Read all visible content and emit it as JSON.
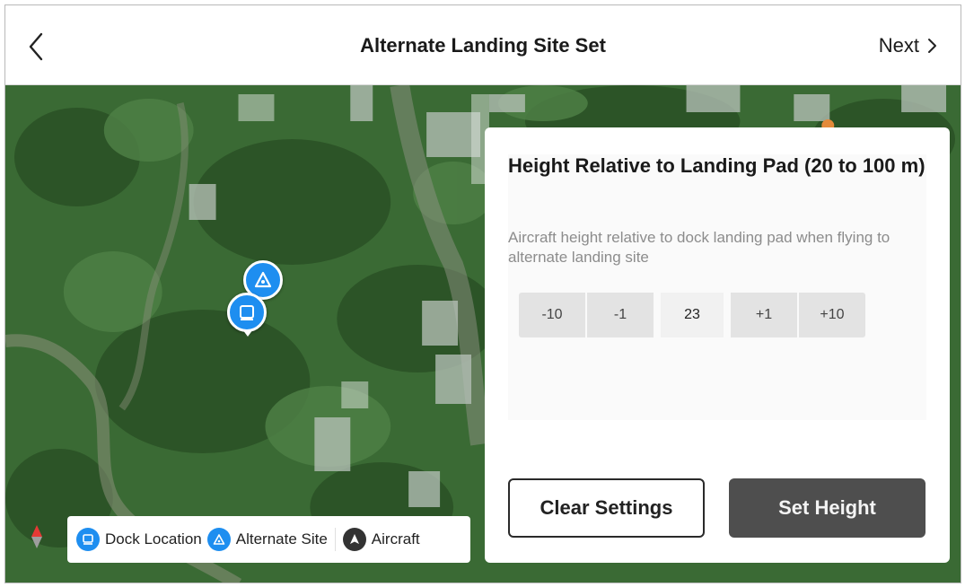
{
  "header": {
    "title": "Alternate Landing Site Set",
    "next_label": "Next"
  },
  "map": {
    "markers": [
      {
        "name": "alternate-site",
        "icon": "triangle-icon",
        "color": "#1e8ef0"
      },
      {
        "name": "dock-location",
        "icon": "dock-icon",
        "color": "#1e8ef0"
      }
    ]
  },
  "legend": {
    "items": [
      {
        "label": "Dock Location",
        "icon": "dock-icon",
        "color": "#1e8ef0"
      },
      {
        "label": "Alternate Site",
        "icon": "triangle-icon",
        "color": "#1e8ef0"
      },
      {
        "label": "Aircraft",
        "icon": "aircraft-arrow-icon",
        "color": "#333333"
      }
    ]
  },
  "panel": {
    "title": "Height Relative to Landing Pad (20 to 100 m)",
    "description": "Aircraft height relative to dock landing pad when flying to alternate landing site",
    "stepper": {
      "decrease_10": "-10",
      "decrease_1": "-1",
      "value": "23",
      "increase_1": "+1",
      "increase_10": "+10"
    },
    "clear_label": "Clear Settings",
    "set_label": "Set Height"
  },
  "colors": {
    "accent": "#1e8ef0",
    "set_button_bg": "#4e4e4e"
  }
}
